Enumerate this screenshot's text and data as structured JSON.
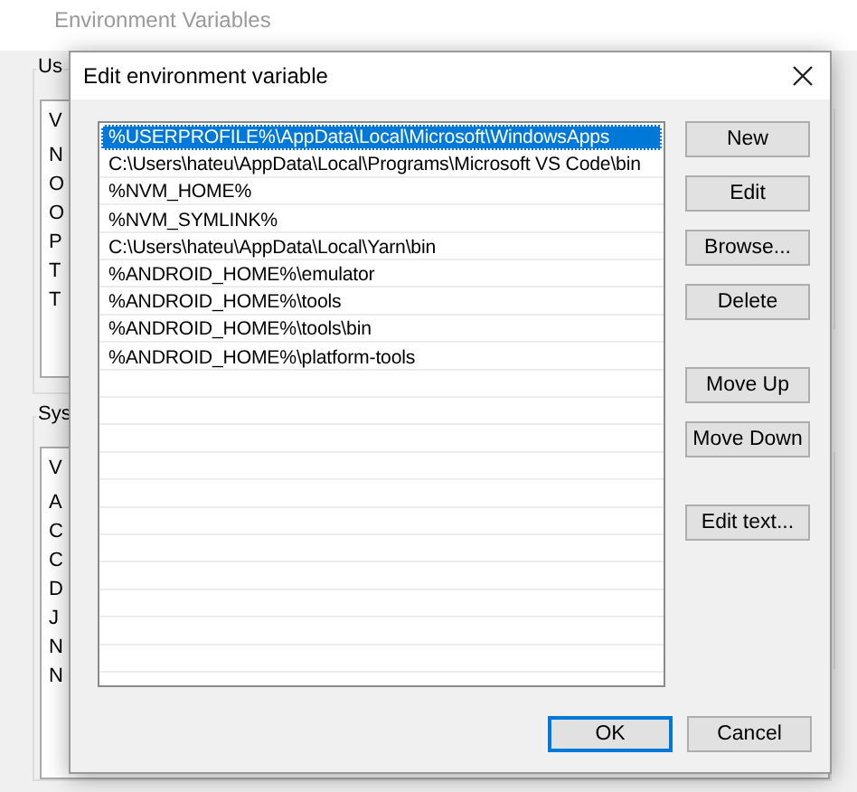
{
  "back_window": {
    "title": "Environment Variables",
    "user_group": {
      "label": "Us",
      "header": "V",
      "rows": [
        "N",
        "O",
        "O",
        "P",
        "T",
        "T"
      ]
    },
    "system_group": {
      "label": "Sys",
      "header": "V",
      "rows": [
        "A",
        "C",
        "C",
        "D",
        "J",
        "N",
        "N"
      ]
    }
  },
  "dialog": {
    "title": "Edit environment variable",
    "entries": [
      {
        "text": "%USERPROFILE%\\AppData\\Local\\Microsoft\\WindowsApps",
        "selected": true
      },
      {
        "text": "C:\\Users\\hateu\\AppData\\Local\\Programs\\Microsoft VS Code\\bin",
        "selected": false
      },
      {
        "text": "%NVM_HOME%",
        "selected": false
      },
      {
        "text": "%NVM_SYMLINK%",
        "selected": false
      },
      {
        "text": "C:\\Users\\hateu\\AppData\\Local\\Yarn\\bin",
        "selected": false
      },
      {
        "text": "%ANDROID_HOME%\\emulator",
        "selected": false
      },
      {
        "text": "%ANDROID_HOME%\\tools",
        "selected": false
      },
      {
        "text": "%ANDROID_HOME%\\tools\\bin",
        "selected": false
      },
      {
        "text": "%ANDROID_HOME%\\platform-tools",
        "selected": false
      }
    ],
    "button_groups": [
      [
        "New",
        "Edit",
        "Browse...",
        "Delete"
      ],
      [
        "Move Up",
        "Move Down"
      ],
      [
        "Edit text..."
      ]
    ],
    "footer_buttons": [
      {
        "label": "OK",
        "default": true
      },
      {
        "label": "Cancel",
        "default": false
      }
    ]
  }
}
